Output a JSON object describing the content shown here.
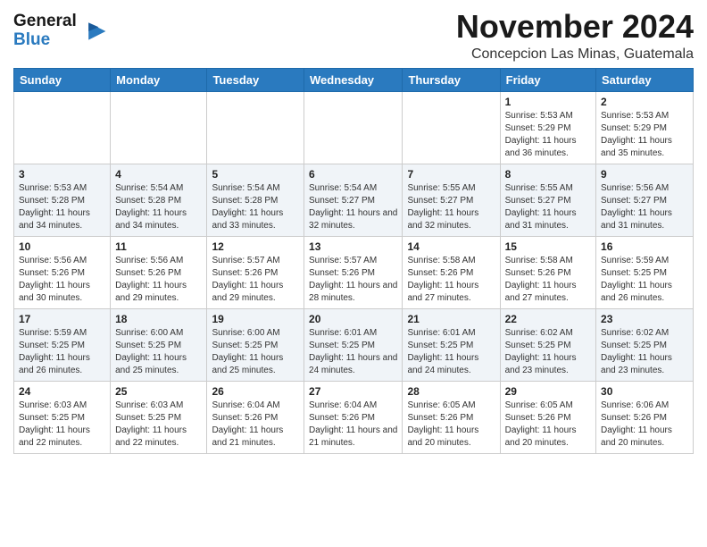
{
  "header": {
    "logo_line1": "General",
    "logo_line2": "Blue",
    "month": "November 2024",
    "location": "Concepcion Las Minas, Guatemala"
  },
  "weekdays": [
    "Sunday",
    "Monday",
    "Tuesday",
    "Wednesday",
    "Thursday",
    "Friday",
    "Saturday"
  ],
  "weeks": [
    [
      {
        "day": "",
        "info": ""
      },
      {
        "day": "",
        "info": ""
      },
      {
        "day": "",
        "info": ""
      },
      {
        "day": "",
        "info": ""
      },
      {
        "day": "",
        "info": ""
      },
      {
        "day": "1",
        "info": "Sunrise: 5:53 AM\nSunset: 5:29 PM\nDaylight: 11 hours and 36 minutes."
      },
      {
        "day": "2",
        "info": "Sunrise: 5:53 AM\nSunset: 5:29 PM\nDaylight: 11 hours and 35 minutes."
      }
    ],
    [
      {
        "day": "3",
        "info": "Sunrise: 5:53 AM\nSunset: 5:28 PM\nDaylight: 11 hours and 34 minutes."
      },
      {
        "day": "4",
        "info": "Sunrise: 5:54 AM\nSunset: 5:28 PM\nDaylight: 11 hours and 34 minutes."
      },
      {
        "day": "5",
        "info": "Sunrise: 5:54 AM\nSunset: 5:28 PM\nDaylight: 11 hours and 33 minutes."
      },
      {
        "day": "6",
        "info": "Sunrise: 5:54 AM\nSunset: 5:27 PM\nDaylight: 11 hours and 32 minutes."
      },
      {
        "day": "7",
        "info": "Sunrise: 5:55 AM\nSunset: 5:27 PM\nDaylight: 11 hours and 32 minutes."
      },
      {
        "day": "8",
        "info": "Sunrise: 5:55 AM\nSunset: 5:27 PM\nDaylight: 11 hours and 31 minutes."
      },
      {
        "day": "9",
        "info": "Sunrise: 5:56 AM\nSunset: 5:27 PM\nDaylight: 11 hours and 31 minutes."
      }
    ],
    [
      {
        "day": "10",
        "info": "Sunrise: 5:56 AM\nSunset: 5:26 PM\nDaylight: 11 hours and 30 minutes."
      },
      {
        "day": "11",
        "info": "Sunrise: 5:56 AM\nSunset: 5:26 PM\nDaylight: 11 hours and 29 minutes."
      },
      {
        "day": "12",
        "info": "Sunrise: 5:57 AM\nSunset: 5:26 PM\nDaylight: 11 hours and 29 minutes."
      },
      {
        "day": "13",
        "info": "Sunrise: 5:57 AM\nSunset: 5:26 PM\nDaylight: 11 hours and 28 minutes."
      },
      {
        "day": "14",
        "info": "Sunrise: 5:58 AM\nSunset: 5:26 PM\nDaylight: 11 hours and 27 minutes."
      },
      {
        "day": "15",
        "info": "Sunrise: 5:58 AM\nSunset: 5:26 PM\nDaylight: 11 hours and 27 minutes."
      },
      {
        "day": "16",
        "info": "Sunrise: 5:59 AM\nSunset: 5:25 PM\nDaylight: 11 hours and 26 minutes."
      }
    ],
    [
      {
        "day": "17",
        "info": "Sunrise: 5:59 AM\nSunset: 5:25 PM\nDaylight: 11 hours and 26 minutes."
      },
      {
        "day": "18",
        "info": "Sunrise: 6:00 AM\nSunset: 5:25 PM\nDaylight: 11 hours and 25 minutes."
      },
      {
        "day": "19",
        "info": "Sunrise: 6:00 AM\nSunset: 5:25 PM\nDaylight: 11 hours and 25 minutes."
      },
      {
        "day": "20",
        "info": "Sunrise: 6:01 AM\nSunset: 5:25 PM\nDaylight: 11 hours and 24 minutes."
      },
      {
        "day": "21",
        "info": "Sunrise: 6:01 AM\nSunset: 5:25 PM\nDaylight: 11 hours and 24 minutes."
      },
      {
        "day": "22",
        "info": "Sunrise: 6:02 AM\nSunset: 5:25 PM\nDaylight: 11 hours and 23 minutes."
      },
      {
        "day": "23",
        "info": "Sunrise: 6:02 AM\nSunset: 5:25 PM\nDaylight: 11 hours and 23 minutes."
      }
    ],
    [
      {
        "day": "24",
        "info": "Sunrise: 6:03 AM\nSunset: 5:25 PM\nDaylight: 11 hours and 22 minutes."
      },
      {
        "day": "25",
        "info": "Sunrise: 6:03 AM\nSunset: 5:25 PM\nDaylight: 11 hours and 22 minutes."
      },
      {
        "day": "26",
        "info": "Sunrise: 6:04 AM\nSunset: 5:26 PM\nDaylight: 11 hours and 21 minutes."
      },
      {
        "day": "27",
        "info": "Sunrise: 6:04 AM\nSunset: 5:26 PM\nDaylight: 11 hours and 21 minutes."
      },
      {
        "day": "28",
        "info": "Sunrise: 6:05 AM\nSunset: 5:26 PM\nDaylight: 11 hours and 20 minutes."
      },
      {
        "day": "29",
        "info": "Sunrise: 6:05 AM\nSunset: 5:26 PM\nDaylight: 11 hours and 20 minutes."
      },
      {
        "day": "30",
        "info": "Sunrise: 6:06 AM\nSunset: 5:26 PM\nDaylight: 11 hours and 20 minutes."
      }
    ]
  ]
}
